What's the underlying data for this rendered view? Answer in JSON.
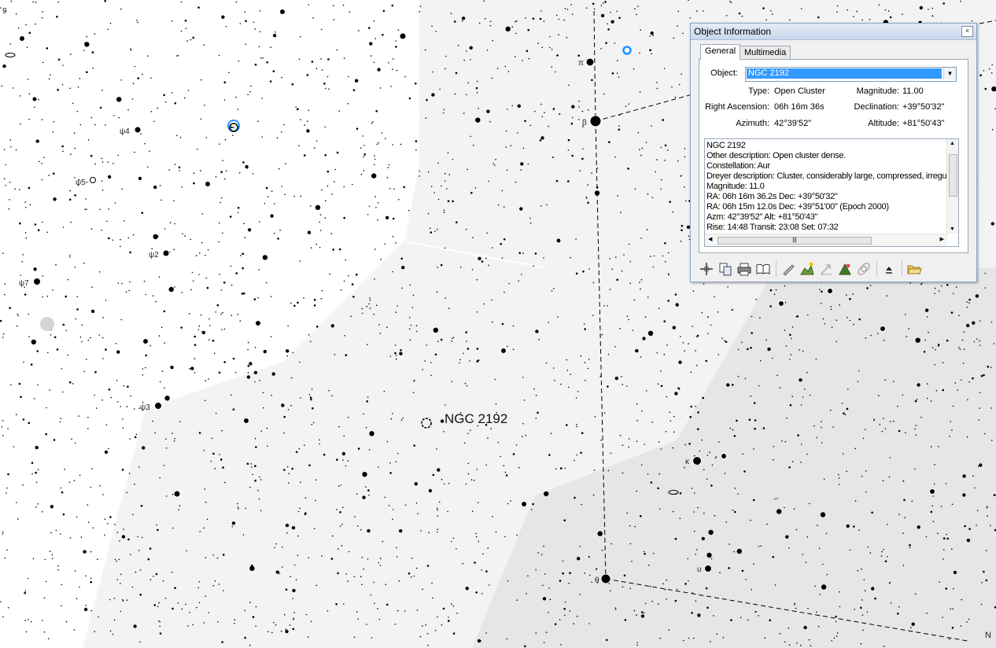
{
  "star_labels": [
    {
      "text": "9"
    },
    {
      "text": "ψ4"
    },
    {
      "text": "ψ5"
    },
    {
      "text": "ψ2"
    },
    {
      "text": "ψ7"
    },
    {
      "text": "ψ3"
    },
    {
      "text": "π"
    },
    {
      "text": "β"
    },
    {
      "text": "θ"
    },
    {
      "text": "υ"
    },
    {
      "text": "κ"
    }
  ],
  "target_label": "NGC 2192",
  "edge_label": "N",
  "colors": {
    "sky": "#ffffff",
    "constellation_area": "#f3f3f3",
    "constellation_area_dark": "#e6e6e6",
    "highlight": "#1e90ff",
    "selection": "#3399ff"
  },
  "dialog": {
    "title": "Object Information",
    "close_label": "×",
    "tabs": [
      {
        "label": "General",
        "active": true
      },
      {
        "label": "Multimedia",
        "active": false
      }
    ],
    "object_label": "Object:",
    "object_value": "NGC 2192",
    "fields": {
      "type_label": "Type:",
      "type_value": "Open Cluster",
      "magnitude_label": "Magnitude:",
      "magnitude_value": "11.00",
      "ra_label": "Right Ascension:",
      "ra_value": "06h 16m 36s",
      "dec_label": "Declination:",
      "dec_value": "+39°50'32\"",
      "azimuth_label": "Azimuth:",
      "azimuth_value": "42°39'52\"",
      "altitude_label": "Altitude:",
      "altitude_value": "+81°50'43\""
    },
    "description_lines": [
      "NGC 2192",
      "Other description: Open cluster dense.",
      "Constellation:  Aur",
      "Dreyer description: Cluster, considerably large, compressed, irregu",
      "Magnitude:  11.0",
      "RA: 06h 16m 36.2s  Dec: +39°50'32\"",
      "RA: 06h 15m 12.0s  Dec: +39°51'00\"  (Epoch 2000)",
      "Azm: 42°39'52\"  Alt: +81°50'43\"",
      "Rise: 14:48  Transit: 23:08  Set: 07:32"
    ],
    "toolbar_icons": [
      "center-object-icon",
      "copy-icon",
      "print-icon",
      "book-icon",
      "draw-icon",
      "chart-icon",
      "arrow-icon",
      "tree-icon",
      "link-icon",
      "collapse-icon",
      "open-folder-icon"
    ]
  }
}
